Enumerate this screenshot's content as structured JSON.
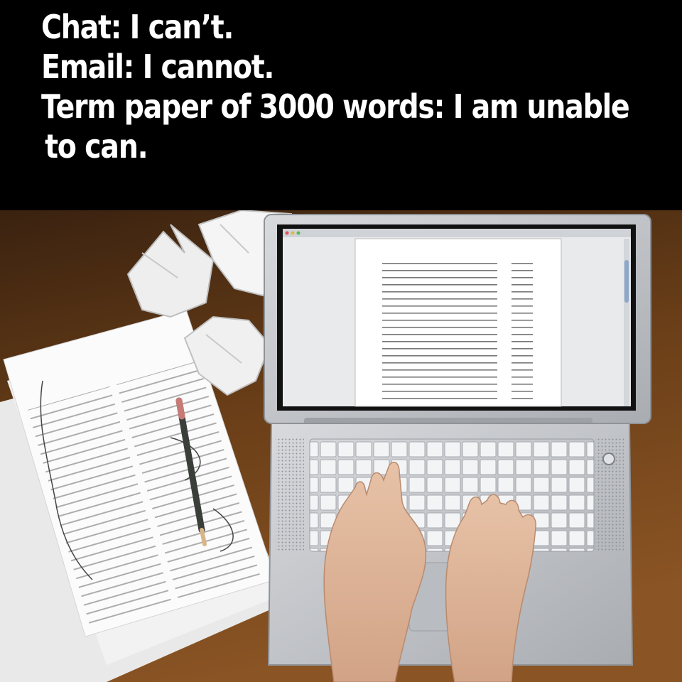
{
  "caption": {
    "line1": "Chat: I can’t.",
    "line2": "Email: I cannot.",
    "line3": "Term paper of 3000 words: I am unable",
    "line4": "to can."
  },
  "colors": {
    "background": "#000000",
    "caption_text": "#ffffff",
    "desk": "#5a3515",
    "laptop": "#c4c7cb"
  }
}
